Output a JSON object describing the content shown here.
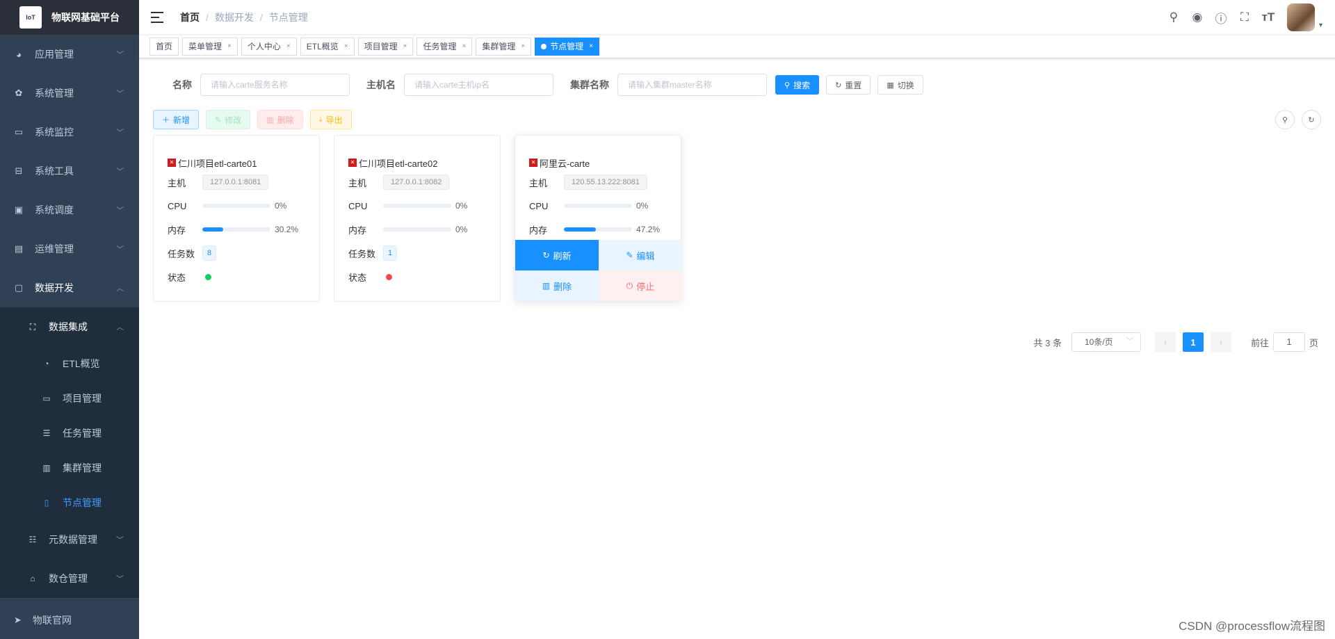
{
  "app": {
    "title": "物联网基础平台",
    "logo_text": "IoT"
  },
  "sidebar": {
    "items": [
      {
        "label": "应用管理",
        "icon": "globe-icon"
      },
      {
        "label": "系统管理",
        "icon": "gear-icon"
      },
      {
        "label": "系统监控",
        "icon": "monitor-icon"
      },
      {
        "label": "系统工具",
        "icon": "toolbox-icon"
      },
      {
        "label": "系统调度",
        "icon": "schedule-icon"
      },
      {
        "label": "运维管理",
        "icon": "ops-icon"
      },
      {
        "label": "数据开发",
        "icon": "code-icon"
      }
    ],
    "group": {
      "label": "数据集成",
      "icon": "hierarchy-icon"
    },
    "subitems": [
      {
        "label": "ETL概览",
        "icon": "dashboard-icon"
      },
      {
        "label": "项目管理",
        "icon": "folder-icon"
      },
      {
        "label": "任务管理",
        "icon": "task-icon"
      },
      {
        "label": "集群管理",
        "icon": "cluster-icon"
      },
      {
        "label": "节点管理",
        "icon": "node-icon"
      }
    ],
    "after": [
      {
        "label": "元数据管理",
        "icon": "database-icon"
      },
      {
        "label": "数仓管理",
        "icon": "warehouse-icon"
      }
    ],
    "footer": {
      "label": "物联官网",
      "icon": "send-icon"
    }
  },
  "breadcrumb": {
    "home": "首页",
    "mid": "数据开发",
    "current": "节点管理",
    "sep": "/"
  },
  "tags": [
    "首页",
    "菜单管理",
    "个人中心",
    "ETL概览",
    "项目管理",
    "任务管理",
    "集群管理",
    "节点管理"
  ],
  "search": {
    "name_label": "名称",
    "name_placeholder": "请输入carte服务名称",
    "host_label": "主机名",
    "host_placeholder": "请输入carte主机ip名",
    "cluster_label": "集群名称",
    "cluster_placeholder": "请输入集群master名称",
    "search_btn": "搜索",
    "reset_btn": "重置",
    "toggle_btn": "切换"
  },
  "toolbar": {
    "add": "新增",
    "edit": "修改",
    "delete": "删除",
    "export": "导出"
  },
  "card_labels": {
    "host": "主机",
    "cpu": "CPU",
    "mem": "内存",
    "tasks": "任务数",
    "status": "状态"
  },
  "cards": [
    {
      "name": "仁川项目etl-carte01",
      "host": "127.0.0.1:8081",
      "cpu": "0%",
      "cpu_value": 0,
      "mem": "30.2%",
      "mem_value": 30.2,
      "tasks": "8",
      "status_color": "#13ce66"
    },
    {
      "name": "仁川项目etl-carte02",
      "host": "127.0.0.1:8082",
      "cpu": "0%",
      "cpu_value": 0,
      "mem": "0%",
      "mem_value": 0,
      "tasks": "1",
      "status_color": "#ff4949"
    },
    {
      "name": "阿里云-carte",
      "host": "120.55.13.222:8081",
      "cpu": "0%",
      "cpu_value": 0,
      "mem": "47.2%",
      "mem_value": 47.2
    }
  ],
  "card_actions": {
    "refresh": "刷新",
    "edit": "编辑",
    "delete": "删除",
    "stop": "停止"
  },
  "pagination": {
    "total": "共 3 条",
    "page_size": "10条/页",
    "current": "1",
    "goto_prefix": "前往",
    "goto_value": "1",
    "goto_suffix": "页"
  },
  "watermark": "CSDN @processflow流程图",
  "colors": {
    "primary": "#1890ff",
    "sidebar_bg": "#304156",
    "active_menu": "#409eff"
  }
}
